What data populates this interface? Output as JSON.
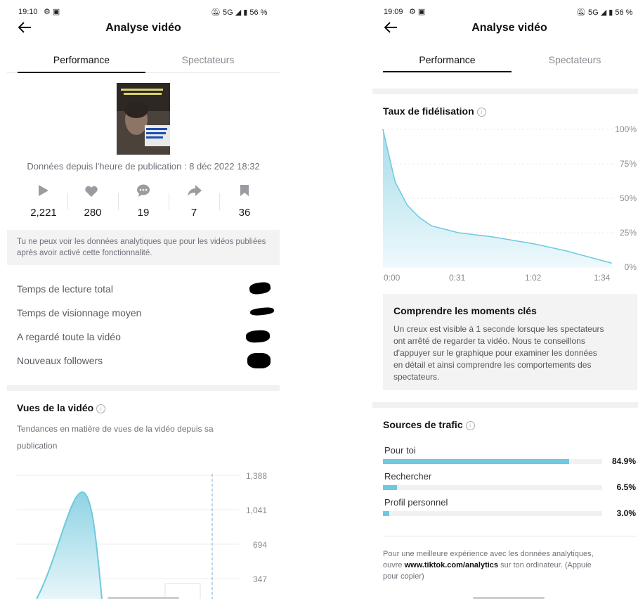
{
  "left": {
    "status_time": "19:10",
    "status_right": "5G ◢ ▮ 56 %",
    "title": "Analyse vidéo",
    "tabs": [
      {
        "label": "Performance"
      },
      {
        "label": "Spectateurs"
      }
    ],
    "thumbnail_caption": "Données depuis l'heure de publication : 8 déc 2022 18:32",
    "stats": [
      {
        "icon": "play-icon",
        "value": "2,221"
      },
      {
        "icon": "heart-icon",
        "value": "280"
      },
      {
        "icon": "comment-icon",
        "value": "19"
      },
      {
        "icon": "share-icon",
        "value": "7"
      },
      {
        "icon": "bookmark-icon",
        "value": "36"
      }
    ],
    "notice": "Tu ne peux voir les données analytiques que pour les vidéos publiées après avoir activé cette fonctionnalité.",
    "metrics": [
      {
        "label": "Temps de lecture total"
      },
      {
        "label": "Temps de visionnage moyen"
      },
      {
        "label": "A regardé toute la vidéo"
      },
      {
        "label": "Nouveaux followers"
      }
    ],
    "views_title": "Vues de la vidéo",
    "views_subtitle_line1": "Tendances en matière de vues de la vidéo depuis sa",
    "views_subtitle_line2": "publication",
    "views_chart": {
      "type": "area",
      "yticks": [
        "1,388",
        "1,041",
        "694",
        "347"
      ]
    }
  },
  "right": {
    "status_time": "19:09",
    "status_right": "5G ◢ ▮ 56 %",
    "title": "Analyse vidéo",
    "tabs": [
      {
        "label": "Performance"
      },
      {
        "label": "Spectateurs"
      }
    ],
    "retention_title": "Taux de fidélisation",
    "retention_chart": {
      "type": "area",
      "yticks": [
        "100%",
        "75%",
        "50%",
        "25%",
        "0%"
      ],
      "xticks": [
        "0:00",
        "0:31",
        "1:02",
        "1:34"
      ]
    },
    "moments_title": "Comprendre les moments clés",
    "moments_text_lines": [
      "Un creux est visible à 1 seconde lorsque les spectateurs",
      "ont arrêté de regarder ta vidéo. Nous te conseillons",
      "d'appuyer sur le graphique pour examiner les données",
      "en détail et ainsi comprendre les comportements des",
      "spectateurs."
    ],
    "traffic_title": "Sources de trafic",
    "traffic": [
      {
        "label": "Pour toi",
        "pct": "84.9%",
        "value": 84.9
      },
      {
        "label": "Rechercher",
        "pct": "6.5%",
        "value": 6.5
      },
      {
        "label": "Profil personnel",
        "pct": "3.0%",
        "value": 3.0
      }
    ],
    "footer_line1": "Pour une meilleure expérience avec les données analytiques,",
    "footer_pre": "ouvre ",
    "footer_link": "www.tiktok.com/analytics",
    "footer_post": " sur ton ordinateur. (Appuie",
    "footer_line3": "pour copier)"
  },
  "chart_data": [
    {
      "type": "area",
      "title": "Taux de fidélisation",
      "x": [
        "0:00",
        "0:05",
        "0:10",
        "0:15",
        "0:20",
        "0:31",
        "0:45",
        "1:02",
        "1:15",
        "1:34"
      ],
      "values": [
        100,
        62,
        45,
        36,
        30,
        25,
        22,
        17,
        12,
        3
      ],
      "yticks": [
        "0%",
        "25%",
        "50%",
        "75%",
        "100%"
      ],
      "ylim": [
        0,
        100
      ]
    },
    {
      "type": "area",
      "title": "Vues de la vidéo",
      "yticks": [
        "347",
        "694",
        "1,041",
        "1,388"
      ],
      "ylim": [
        0,
        1388
      ],
      "peak": 1250
    }
  ]
}
